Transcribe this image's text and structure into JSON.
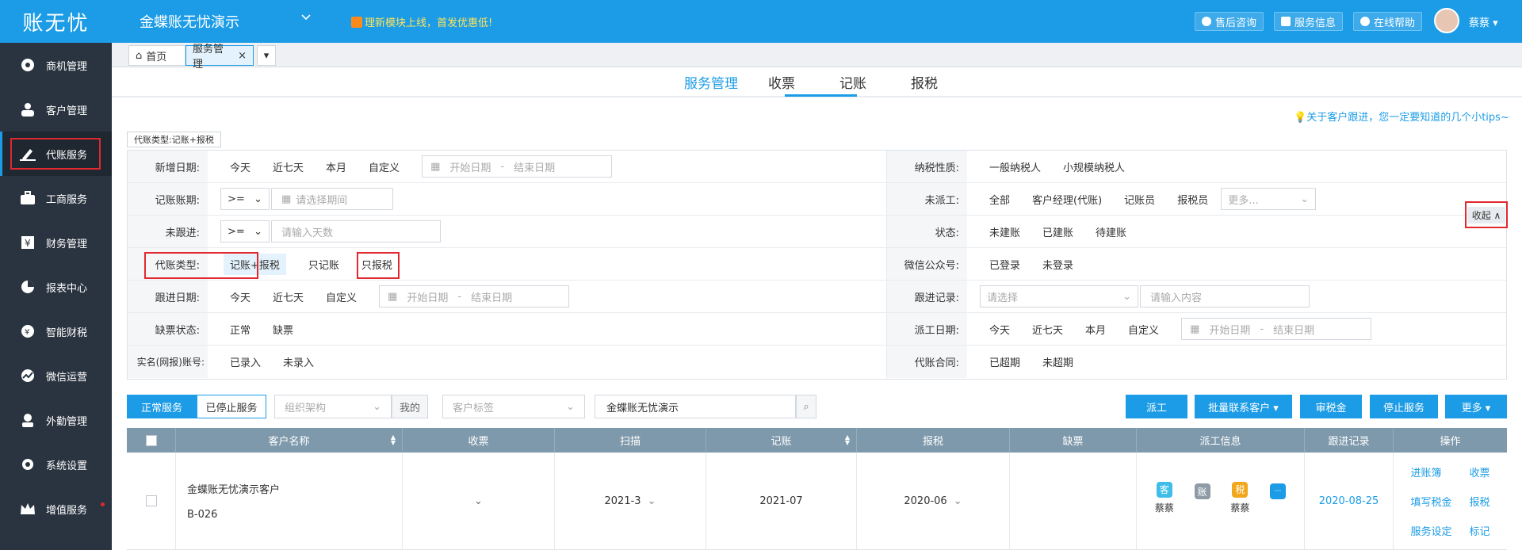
{
  "app": {
    "logo": "账无忧"
  },
  "sidebar": {
    "items": [
      {
        "label": "商机管理",
        "icon": "target-icon"
      },
      {
        "label": "客户管理",
        "icon": "users-icon"
      },
      {
        "label": "代账服务",
        "icon": "pen-icon"
      },
      {
        "label": "工商服务",
        "icon": "briefcase-icon"
      },
      {
        "label": "财务管理",
        "icon": "yen-icon"
      },
      {
        "label": "报表中心",
        "icon": "pie-chart-icon"
      },
      {
        "label": "智能财税",
        "icon": "smart-tax-icon"
      },
      {
        "label": "微信运营",
        "icon": "trend-icon"
      },
      {
        "label": "外勤管理",
        "icon": "field-icon"
      },
      {
        "label": "系统设置",
        "icon": "gear-icon"
      },
      {
        "label": "增值服务",
        "icon": "crown-icon"
      }
    ]
  },
  "header": {
    "company": "金蝶账无忧演示",
    "promo": "理新模块上线，首发优惠低!",
    "buttons": {
      "after_sales": "售后咨询",
      "service_info": "服务信息",
      "online_help": "在线帮助"
    },
    "user": "蔡蔡"
  },
  "page_tabs": {
    "home": "首页",
    "service": "服务管理"
  },
  "subnav": {
    "service": "服务管理",
    "receipt": "收票",
    "bookkeeping": "记账",
    "tax": "报税"
  },
  "tips": "关于客户跟进，您一定要知道的几个小tips~",
  "active_tag": "代账类型:记账+报税",
  "filters": {
    "new_date": {
      "label": "新增日期:",
      "opts": [
        "今天",
        "近七天",
        "本月",
        "自定义"
      ],
      "start": "开始日期",
      "sep": "-",
      "end": "结束日期"
    },
    "period": {
      "label": "记账账期:",
      "op": ">=",
      "placeholder": "请选择期间"
    },
    "unfollow": {
      "label": "未跟进:",
      "op": ">=",
      "placeholder": "请输入天数"
    },
    "type": {
      "label": "代账类型:",
      "opts": [
        "记账+报税",
        "只记账",
        "只报税"
      ]
    },
    "follow_date": {
      "label": "跟进日期:",
      "opts": [
        "今天",
        "近七天",
        "自定义"
      ],
      "start": "开始日期",
      "sep": "-",
      "end": "结束日期"
    },
    "missing": {
      "label": "缺票状态:",
      "opts": [
        "正常",
        "缺票"
      ]
    },
    "realname": {
      "label": "实名(网报)账号:",
      "opts": [
        "已录入",
        "未录入"
      ]
    },
    "taxpayer": {
      "label": "纳税性质:",
      "opts": [
        "一般纳税人",
        "小规模纳税人"
      ]
    },
    "undispatched": {
      "label": "未派工:",
      "opts": [
        "全部",
        "客户经理(代账)",
        "记账员",
        "报税员"
      ],
      "more": "更多..."
    },
    "status": {
      "label": "状态:",
      "opts": [
        "未建账",
        "已建账",
        "待建账"
      ]
    },
    "wechat": {
      "label": "微信公众号:",
      "opts": [
        "已登录",
        "未登录"
      ]
    },
    "follow_record": {
      "label": "跟进记录:",
      "select": "请选择",
      "input": "请输入内容"
    },
    "dispatch_date": {
      "label": "派工日期:",
      "opts": [
        "今天",
        "近七天",
        "本月",
        "自定义"
      ],
      "start": "开始日期",
      "sep": "-",
      "end": "结束日期"
    },
    "contract": {
      "label": "代账合同:",
      "opts": [
        "已超期",
        "未超期"
      ]
    },
    "collapse": "收起 ∧"
  },
  "toolbar": {
    "normal": "正常服务",
    "stopped": "已停止服务",
    "org": "组织架构",
    "mine": "我的",
    "tag": "客户标签",
    "search": "金蝶账无忧演示",
    "dispatch": "派工",
    "batch_contact": "批量联系客户 ▾",
    "audit_tax": "审税金",
    "stop": "停止服务",
    "more": "更多 ▾"
  },
  "table": {
    "headers": [
      "客户名称",
      "收票",
      "扫描",
      "记账",
      "报税",
      "缺票",
      "派工信息",
      "跟进记录",
      "操作"
    ],
    "row": {
      "name": "金蝶账无忧演示客户",
      "code": "B-026",
      "scan": "2021-3",
      "bookkeeping": "2021-07",
      "tax": "2020-06",
      "badges": [
        {
          "char": "客",
          "color": "#3dbde8",
          "person": "蔡蔡"
        },
        {
          "char": "账",
          "color": "#8e9aa5",
          "person": ""
        },
        {
          "char": "税",
          "color": "#f2a81d",
          "person": "蔡蔡"
        },
        {
          "char": "···",
          "color": "#1c9ce6",
          "person": ""
        }
      ],
      "follow": "2020-08-25",
      "ops": [
        "进账簿",
        "收票",
        "填写税金",
        "报税",
        "服务设定",
        "标记"
      ]
    }
  }
}
